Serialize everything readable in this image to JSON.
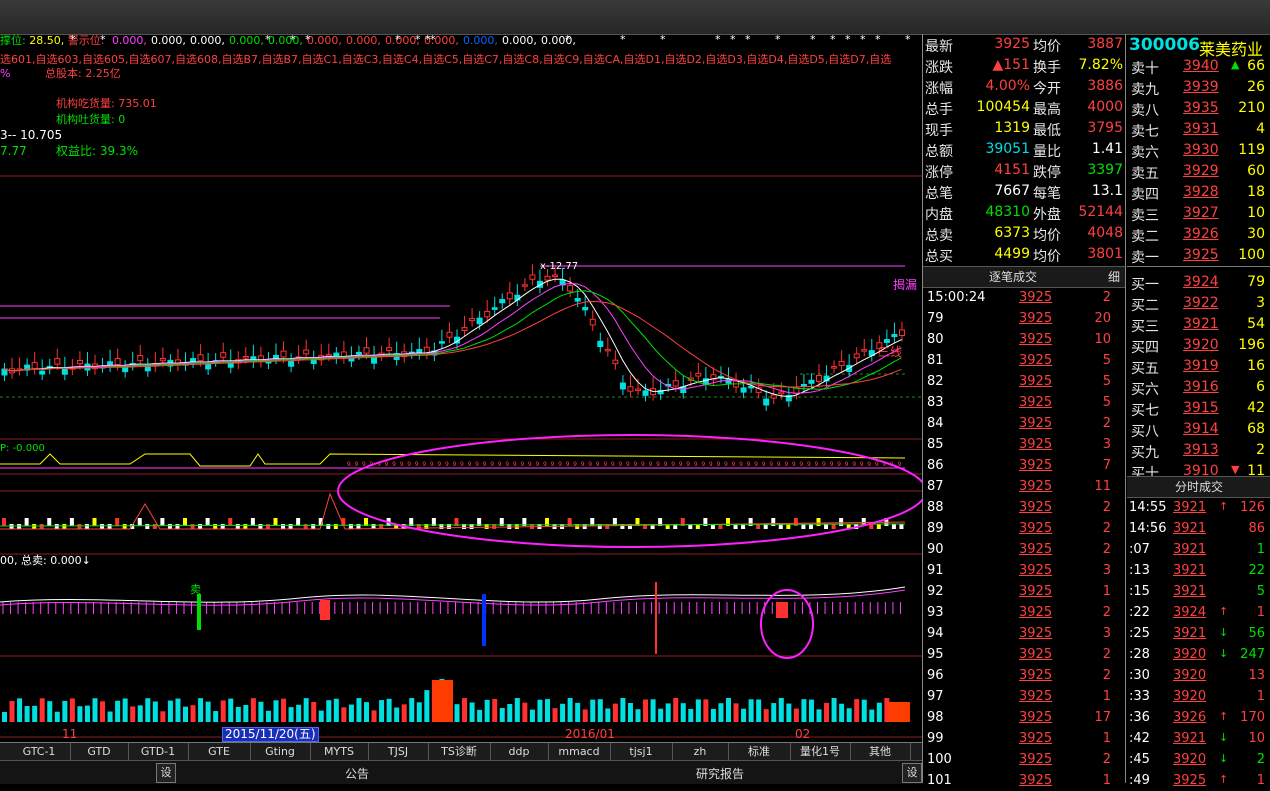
{
  "top_indicators": {
    "stop_label": "撑位:",
    "stop_value": "28.50,",
    "warn_label": "警示位:",
    "warn_values": [
      "0.000,",
      "0.000,",
      "0.000,",
      "0.000,",
      "0.000,",
      "0.000,",
      "0.000,",
      "0.000,",
      "0.000,",
      "0.000,",
      "0.000,",
      "0.000,"
    ],
    "self_select": "选601,自选603,自选605,自选607,自选608,自选B7,自选B7,自选C1,自选C3,自选C4,自选C5,自选C7,自选C8,自选C9,自选CA,自选D1,自选D2,自选D3,自选D4,自选D5,自选D7,自选",
    "pct": "%",
    "total_share": "总股本: 2.25亿",
    "inst_buy": "机构吃货量: 735.01",
    "inst_sell": "机构吐货量: 0",
    "price_line": "3-- 10.705",
    "equity": "7.77",
    "equity_ratio": "权益比: 39.3%"
  },
  "chart_labels": {
    "hi_price": "x-12.77",
    "sanxian": "三线",
    "cang": "揭漏",
    "sell_word": "卖",
    "ind1": "P: -0.000",
    "ind3": "00, 总卖: 0.000↓",
    "date1": "2015/11/20(五)",
    "month_11": "11",
    "month_2016": "2016/01",
    "month_02": "02"
  },
  "quote_left": [
    {
      "l": "最新",
      "v": "3925",
      "c": "#ff4040",
      "l2": "均价",
      "v2": "3887",
      "c2": "#ff4040"
    },
    {
      "l": "涨跌",
      "v": "▲151",
      "c": "#ff4040",
      "l2": "换手",
      "v2": "7.82%",
      "c2": "#ffff00"
    },
    {
      "l": "涨幅",
      "v": "4.00%",
      "c": "#ff4040",
      "l2": "今开",
      "v2": "3886",
      "c2": "#ff4040"
    },
    {
      "l": "总手",
      "v": "100454",
      "c": "#ffff00",
      "l2": "最高",
      "v2": "4000",
      "c2": "#ff4040"
    },
    {
      "l": "现手",
      "v": "1319",
      "c": "#ffff00",
      "l2": "最低",
      "v2": "3795",
      "c2": "#ff4040"
    },
    {
      "l": "总额",
      "v": "39051",
      "c": "#00e0e0",
      "l2": "量比",
      "v2": "1.41",
      "c2": "#ffffff"
    },
    {
      "l": "涨停",
      "v": "4151",
      "c": "#ff4040",
      "l2": "跌停",
      "v2": "3397",
      "c2": "#00e000"
    },
    {
      "l": "总笔",
      "v": "7667",
      "c": "#ffffff",
      "l2": "每笔",
      "v2": "13.1",
      "c2": "#ffffff"
    },
    {
      "l": "内盘",
      "v": "48310",
      "c": "#00e000",
      "l2": "外盘",
      "v2": "52144",
      "c2": "#ff4040"
    },
    {
      "l": "总卖",
      "v": "6373",
      "c": "#ffff00",
      "l2": "均价",
      "v2": "4048",
      "c2": "#ff4040"
    },
    {
      "l": "总买",
      "v": "4499",
      "c": "#ffff00",
      "l2": "均价",
      "v2": "3801",
      "c2": "#ff4040"
    }
  ],
  "stock": {
    "code": "300006",
    "name": "莱美药业"
  },
  "order_book": [
    {
      "l": "卖十",
      "p": "3940",
      "a": "▲",
      "q": "66",
      "pc": "#ff4040",
      "ac": "#00e000"
    },
    {
      "l": "卖九",
      "p": "3939",
      "a": "",
      "q": "26",
      "pc": "#ff4040",
      "ac": ""
    },
    {
      "l": "卖八",
      "p": "3935",
      "a": "",
      "q": "210",
      "pc": "#ff4040",
      "ac": ""
    },
    {
      "l": "卖七",
      "p": "3931",
      "a": "",
      "q": "4",
      "pc": "#ff4040",
      "ac": ""
    },
    {
      "l": "卖六",
      "p": "3930",
      "a": "",
      "q": "119",
      "pc": "#ff4040",
      "ac": ""
    },
    {
      "l": "卖五",
      "p": "3929",
      "a": "",
      "q": "60",
      "pc": "#ff4040",
      "ac": ""
    },
    {
      "l": "卖四",
      "p": "3928",
      "a": "",
      "q": "18",
      "pc": "#ff4040",
      "ac": ""
    },
    {
      "l": "卖三",
      "p": "3927",
      "a": "",
      "q": "10",
      "pc": "#ff4040",
      "ac": ""
    },
    {
      "l": "卖二",
      "p": "3926",
      "a": "",
      "q": "30",
      "pc": "#ff4040",
      "ac": ""
    },
    {
      "l": "卖一",
      "p": "3925",
      "a": "",
      "q": "100",
      "pc": "#ff4040",
      "ac": ""
    },
    {
      "l": "买一",
      "p": "3924",
      "a": "",
      "q": "79",
      "pc": "#ff4040",
      "ac": ""
    },
    {
      "l": "买二",
      "p": "3922",
      "a": "",
      "q": "3",
      "pc": "#ff4040",
      "ac": ""
    },
    {
      "l": "买三",
      "p": "3921",
      "a": "",
      "q": "54",
      "pc": "#ff4040",
      "ac": ""
    },
    {
      "l": "买四",
      "p": "3920",
      "a": "",
      "q": "196",
      "pc": "#ff4040",
      "ac": ""
    },
    {
      "l": "买五",
      "p": "3919",
      "a": "",
      "q": "16",
      "pc": "#ff4040",
      "ac": ""
    },
    {
      "l": "买六",
      "p": "3916",
      "a": "",
      "q": "6",
      "pc": "#ff4040",
      "ac": ""
    },
    {
      "l": "买七",
      "p": "3915",
      "a": "",
      "q": "42",
      "pc": "#ff4040",
      "ac": ""
    },
    {
      "l": "买八",
      "p": "3914",
      "a": "",
      "q": "68",
      "pc": "#ff4040",
      "ac": ""
    },
    {
      "l": "买九",
      "p": "3913",
      "a": "",
      "q": "2",
      "pc": "#ff4040",
      "ac": ""
    },
    {
      "l": "买十",
      "p": "3910",
      "a": "▼",
      "q": "11",
      "pc": "#ff4040",
      "ac": "#ff4040"
    }
  ],
  "tick_header": "逐笔成交",
  "tick_tab": "细",
  "ticks": [
    {
      "t": "15:00:24",
      "p": "3925",
      "q": "2"
    },
    {
      "t": "79",
      "p": "3925",
      "q": "20"
    },
    {
      "t": "80",
      "p": "3925",
      "q": "10"
    },
    {
      "t": "81",
      "p": "3925",
      "q": "5"
    },
    {
      "t": "82",
      "p": "3925",
      "q": "5"
    },
    {
      "t": "83",
      "p": "3925",
      "q": "5"
    },
    {
      "t": "84",
      "p": "3925",
      "q": "2"
    },
    {
      "t": "85",
      "p": "3925",
      "q": "3"
    },
    {
      "t": "86",
      "p": "3925",
      "q": "7"
    },
    {
      "t": "87",
      "p": "3925",
      "q": "11"
    },
    {
      "t": "88",
      "p": "3925",
      "q": "2"
    },
    {
      "t": "89",
      "p": "3925",
      "q": "2"
    },
    {
      "t": "90",
      "p": "3925",
      "q": "2"
    },
    {
      "t": "91",
      "p": "3925",
      "q": "3"
    },
    {
      "t": "92",
      "p": "3925",
      "q": "1"
    },
    {
      "t": "93",
      "p": "3925",
      "q": "2"
    },
    {
      "t": "94",
      "p": "3925",
      "q": "3"
    },
    {
      "t": "95",
      "p": "3925",
      "q": "2"
    },
    {
      "t": "96",
      "p": "3925",
      "q": "2"
    },
    {
      "t": "97",
      "p": "3925",
      "q": "1"
    },
    {
      "t": "98",
      "p": "3925",
      "q": "17"
    },
    {
      "t": "99",
      "p": "3925",
      "q": "1"
    },
    {
      "t": "100",
      "p": "3925",
      "q": "2"
    },
    {
      "t": "101",
      "p": "3925",
      "q": "1"
    }
  ],
  "deal_header": "分时成交",
  "deals": [
    {
      "t": "14:55",
      "p": "3921",
      "a": "↑",
      "q": "126",
      "ac": "#ff4040",
      "qc": "#ff4040"
    },
    {
      "t": "14:56",
      "p": "3921",
      "a": "",
      "q": "86",
      "ac": "",
      "qc": "#ff4040"
    },
    {
      "t": ":07",
      "p": "3921",
      "a": "",
      "q": "1",
      "ac": "",
      "qc": "#00e000"
    },
    {
      "t": ":13",
      "p": "3921",
      "a": "",
      "q": "22",
      "ac": "",
      "qc": "#00e000"
    },
    {
      "t": ":15",
      "p": "3921",
      "a": "",
      "q": "5",
      "ac": "",
      "qc": "#00e000"
    },
    {
      "t": ":22",
      "p": "3924",
      "a": "↑",
      "q": "1",
      "ac": "#ff4040",
      "qc": "#ff4040"
    },
    {
      "t": ":25",
      "p": "3921",
      "a": "↓",
      "q": "56",
      "ac": "#00e000",
      "qc": "#00e000"
    },
    {
      "t": ":28",
      "p": "3920",
      "a": "↓",
      "q": "247",
      "ac": "#00e000",
      "qc": "#00e000"
    },
    {
      "t": ":30",
      "p": "3920",
      "a": "",
      "q": "13",
      "ac": "",
      "qc": "#ff4040"
    },
    {
      "t": ":33",
      "p": "3920",
      "a": "",
      "q": "1",
      "ac": "",
      "qc": "#ff4040"
    },
    {
      "t": ":36",
      "p": "3926",
      "a": "↑",
      "q": "170",
      "ac": "#ff4040",
      "qc": "#ff4040"
    },
    {
      "t": ":42",
      "p": "3921",
      "a": "↓",
      "q": "10",
      "ac": "#00e000",
      "qc": "#ff4040"
    },
    {
      "t": ":45",
      "p": "3920",
      "a": "↓",
      "q": "2",
      "ac": "#00e000",
      "qc": "#00e000"
    },
    {
      "t": ":49",
      "p": "3925",
      "a": "↑",
      "q": "1",
      "ac": "#ff4040",
      "qc": "#ff4040"
    }
  ],
  "tabs": [
    "GTC-1",
    "GTD",
    "GTD-1",
    "GTE",
    "Gting",
    "MYTS",
    "TJSJ",
    "TS诊断",
    "ddp",
    "mmacd",
    "tjsj1",
    "zh",
    "标准",
    "量化1号",
    "其他"
  ],
  "bottom": {
    "set": "设",
    "notice": "公告",
    "report": "研究报告"
  }
}
